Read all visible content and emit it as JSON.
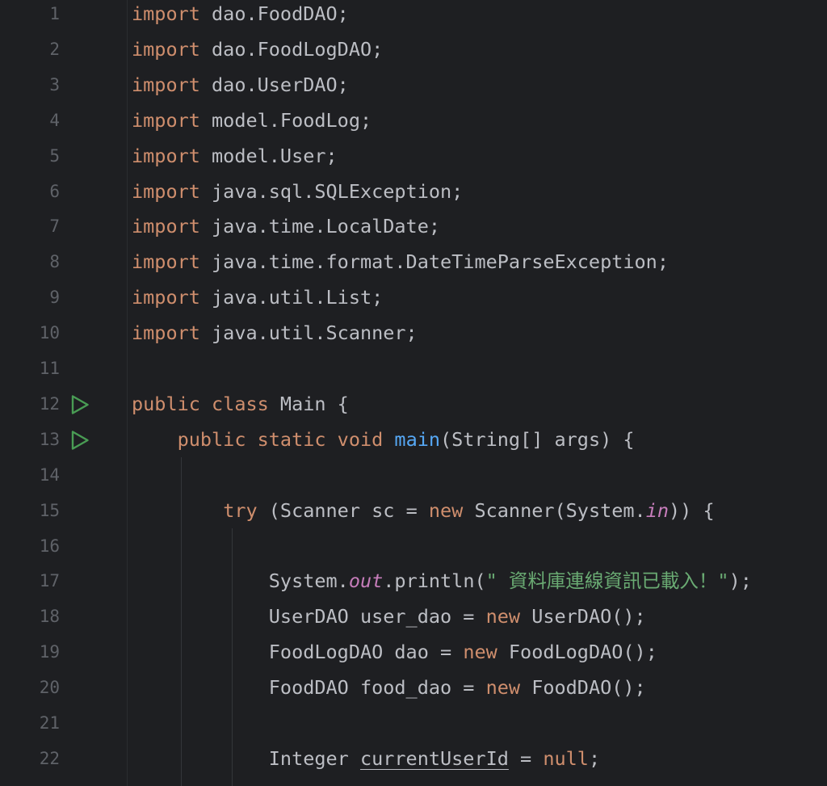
{
  "editor": {
    "language": "java",
    "lines": [
      {
        "number": "1",
        "segments": [
          {
            "t": "import",
            "c": "kw"
          },
          {
            "t": " dao.FoodDAO;",
            "c": ""
          }
        ]
      },
      {
        "number": "2",
        "segments": [
          {
            "t": "import",
            "c": "kw"
          },
          {
            "t": " dao.FoodLogDAO;",
            "c": ""
          }
        ]
      },
      {
        "number": "3",
        "segments": [
          {
            "t": "import",
            "c": "kw"
          },
          {
            "t": " dao.UserDAO;",
            "c": ""
          }
        ]
      },
      {
        "number": "4",
        "segments": [
          {
            "t": "import",
            "c": "kw"
          },
          {
            "t": " model.FoodLog;",
            "c": ""
          }
        ]
      },
      {
        "number": "5",
        "segments": [
          {
            "t": "import",
            "c": "kw"
          },
          {
            "t": " model.User;",
            "c": ""
          }
        ]
      },
      {
        "number": "6",
        "segments": [
          {
            "t": "import",
            "c": "kw"
          },
          {
            "t": " java.sql.SQLException;",
            "c": ""
          }
        ]
      },
      {
        "number": "7",
        "segments": [
          {
            "t": "import",
            "c": "kw"
          },
          {
            "t": " java.time.LocalDate;",
            "c": ""
          }
        ]
      },
      {
        "number": "8",
        "segments": [
          {
            "t": "import",
            "c": "kw"
          },
          {
            "t": " java.time.format.DateTimeParseException;",
            "c": ""
          }
        ]
      },
      {
        "number": "9",
        "segments": [
          {
            "t": "import",
            "c": "kw"
          },
          {
            "t": " java.util.List;",
            "c": ""
          }
        ]
      },
      {
        "number": "10",
        "segments": [
          {
            "t": "import",
            "c": "kw"
          },
          {
            "t": " java.util.Scanner;",
            "c": ""
          }
        ]
      },
      {
        "number": "11",
        "segments": []
      },
      {
        "number": "12",
        "run": true,
        "segments": [
          {
            "t": "public class",
            "c": "kw"
          },
          {
            "t": " Main {",
            "c": ""
          }
        ]
      },
      {
        "number": "13",
        "run": true,
        "segments": [
          {
            "t": "    ",
            "c": ""
          },
          {
            "t": "public static void",
            "c": "kw"
          },
          {
            "t": " ",
            "c": ""
          },
          {
            "t": "main",
            "c": "fn"
          },
          {
            "t": "(String[] args) {",
            "c": ""
          }
        ]
      },
      {
        "number": "14",
        "segments": []
      },
      {
        "number": "15",
        "segments": [
          {
            "t": "        ",
            "c": ""
          },
          {
            "t": "try",
            "c": "kw"
          },
          {
            "t": " (Scanner sc = ",
            "c": ""
          },
          {
            "t": "new",
            "c": "kw"
          },
          {
            "t": " Scanner(System.",
            "c": ""
          },
          {
            "t": "in",
            "c": "st"
          },
          {
            "t": ")) {",
            "c": ""
          }
        ]
      },
      {
        "number": "16",
        "segments": []
      },
      {
        "number": "17",
        "segments": [
          {
            "t": "            System.",
            "c": ""
          },
          {
            "t": "out",
            "c": "st"
          },
          {
            "t": ".println(",
            "c": ""
          },
          {
            "t": "\" 資料庫連線資訊已載入！\"",
            "c": "str"
          },
          {
            "t": ");",
            "c": ""
          }
        ]
      },
      {
        "number": "18",
        "segments": [
          {
            "t": "            UserDAO user_dao = ",
            "c": ""
          },
          {
            "t": "new",
            "c": "kw"
          },
          {
            "t": " UserDAO();",
            "c": ""
          }
        ]
      },
      {
        "number": "19",
        "segments": [
          {
            "t": "            FoodLogDAO dao = ",
            "c": ""
          },
          {
            "t": "new",
            "c": "kw"
          },
          {
            "t": " FoodLogDAO();",
            "c": ""
          }
        ]
      },
      {
        "number": "20",
        "segments": [
          {
            "t": "            FoodDAO food_dao = ",
            "c": ""
          },
          {
            "t": "new",
            "c": "kw"
          },
          {
            "t": " FoodDAO();",
            "c": ""
          }
        ]
      },
      {
        "number": "21",
        "segments": []
      },
      {
        "number": "22",
        "segments": [
          {
            "t": "            Integer ",
            "c": ""
          },
          {
            "t": "currentUserId",
            "c": "var"
          },
          {
            "t": " = ",
            "c": ""
          },
          {
            "t": "null",
            "c": "kw"
          },
          {
            "t": ";",
            "c": ""
          }
        ]
      }
    ]
  },
  "colors": {
    "background": "#1e1f22",
    "line_number": "#5f6268",
    "default_text": "#bcbec4",
    "keyword": "#cf8e6d",
    "method_declaration": "#56a8f5",
    "static_field": "#c77dbb",
    "string": "#6aab73",
    "run_icon": "#499c54"
  },
  "icons": {
    "run": "run-gutter-icon"
  }
}
